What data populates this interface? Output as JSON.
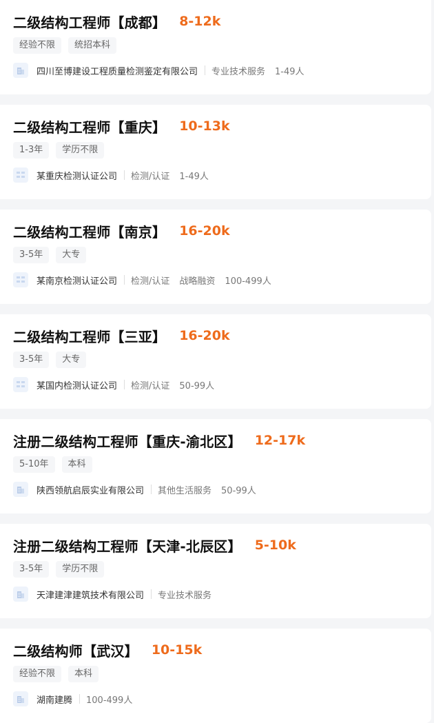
{
  "colors": {
    "salary": "#ee6b1c",
    "background": "#f4f5f7",
    "card": "#ffffff"
  },
  "jobs": [
    {
      "title": "二级结构工程师【成都】",
      "salary": "8-12k",
      "tags": [
        "经验不限",
        "统招本科"
      ],
      "company": "四川至博建设工程质量检测鉴定有限公司",
      "meta": [
        "专业技术服务",
        "1-49人"
      ],
      "logo_icon": "building-icon"
    },
    {
      "title": "二级结构工程师【重庆】",
      "salary": "10-13k",
      "tags": [
        "1-3年",
        "学历不限"
      ],
      "company": "某重庆检测认证公司",
      "meta": [
        "检测/认证",
        "1-49人"
      ],
      "logo_icon": "placeholder-logo-icon"
    },
    {
      "title": "二级结构工程师【南京】",
      "salary": "16-20k",
      "tags": [
        "3-5年",
        "大专"
      ],
      "company": "某南京检测认证公司",
      "meta": [
        "检测/认证",
        "战略融资",
        "100-499人"
      ],
      "logo_icon": "placeholder-logo-icon"
    },
    {
      "title": "二级结构工程师【三亚】",
      "salary": "16-20k",
      "tags": [
        "3-5年",
        "大专"
      ],
      "company": "某国内检测认证公司",
      "meta": [
        "检测/认证",
        "50-99人"
      ],
      "logo_icon": "placeholder-logo-icon"
    },
    {
      "title": "注册二级结构工程师【重庆-渝北区】",
      "salary": "12-17k",
      "tags": [
        "5-10年",
        "本科"
      ],
      "company": "陕西领航启辰实业有限公司",
      "meta": [
        "其他生活服务",
        "50-99人"
      ],
      "logo_icon": "building-icon"
    },
    {
      "title": "注册二级结构工程师【天津-北辰区】",
      "salary": "5-10k",
      "tags": [
        "3-5年",
        "学历不限"
      ],
      "company": "天津建津建筑技术有限公司",
      "meta": [
        "专业技术服务"
      ],
      "logo_icon": "building-icon"
    },
    {
      "title": "二级结构师【武汉】",
      "salary": "10-15k",
      "tags": [
        "经验不限",
        "本科"
      ],
      "company": "湖南建腾",
      "meta": [
        "100-499人"
      ],
      "logo_icon": "building-icon"
    }
  ]
}
